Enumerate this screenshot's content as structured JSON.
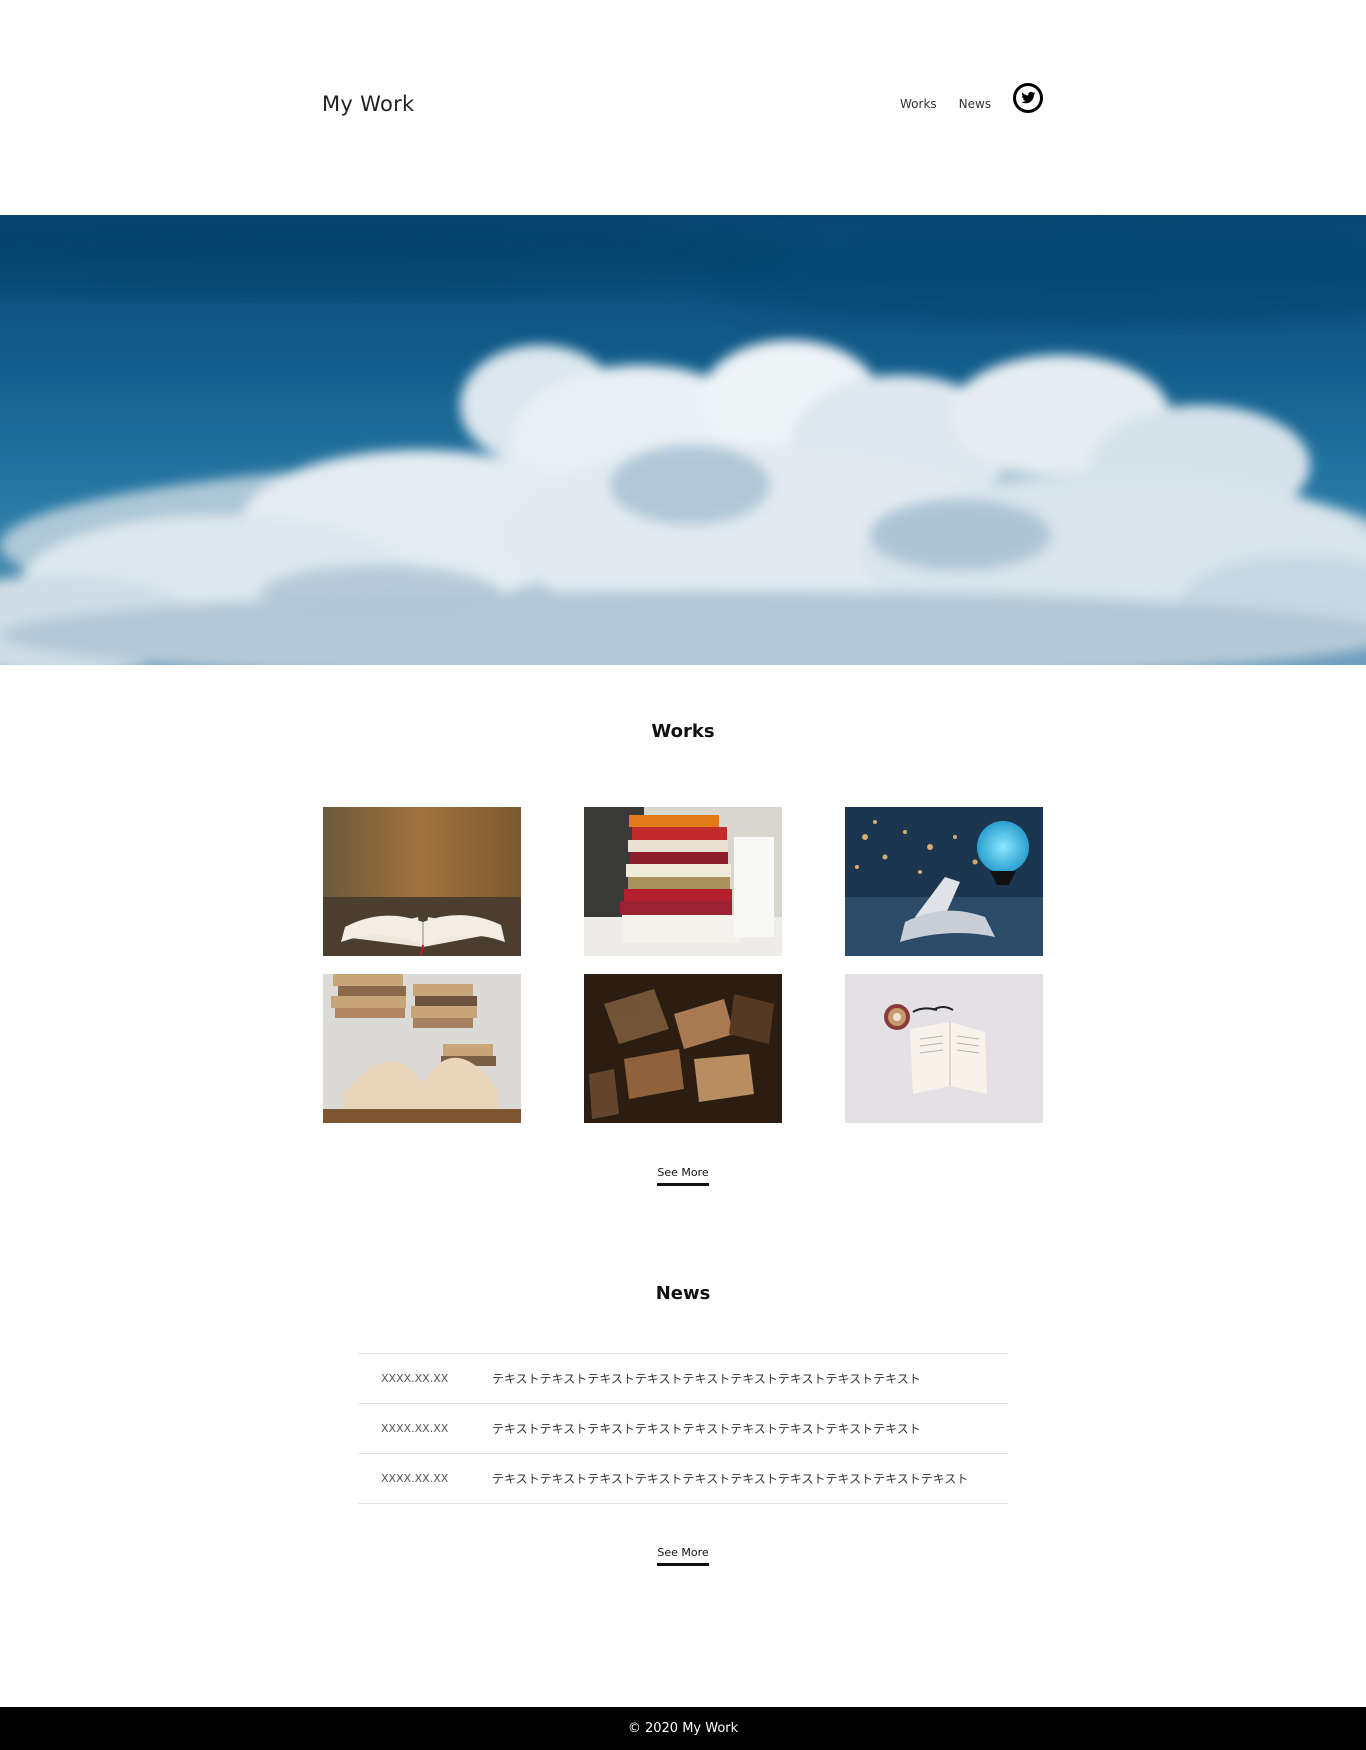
{
  "header": {
    "logo": "My Work",
    "nav": [
      {
        "label": "Works"
      },
      {
        "label": "News"
      }
    ],
    "social_icon": "twitter-icon"
  },
  "hero": {
    "image": "sky-with-clouds",
    "colors": {
      "sky_top": "#0b4a78",
      "sky_mid": "#1a6e9c",
      "cloud": "#e8eef2"
    }
  },
  "works": {
    "title": "Works",
    "items": [
      {
        "image": "open-book-autumn"
      },
      {
        "image": "stacked-books"
      },
      {
        "image": "book-with-moon-lamp"
      },
      {
        "image": "open-book-on-stack"
      },
      {
        "image": "scattered-books-dark"
      },
      {
        "image": "book-coffee-glasses"
      }
    ],
    "see_more": "See More"
  },
  "news": {
    "title": "News",
    "items": [
      {
        "date": "XXXX.XX.XX",
        "text": "テキストテキストテキストテキストテキストテキストテキストテキストテキスト"
      },
      {
        "date": "XXXX.XX.XX",
        "text": "テキストテキストテキストテキストテキストテキストテキストテキストテキスト"
      },
      {
        "date": "XXXX.XX.XX",
        "text": "テキストテキストテキストテキストテキストテキストテキストテキストテキストテキスト"
      }
    ],
    "see_more": "See More"
  },
  "footer": {
    "copyright": "© 2020 My Work"
  }
}
